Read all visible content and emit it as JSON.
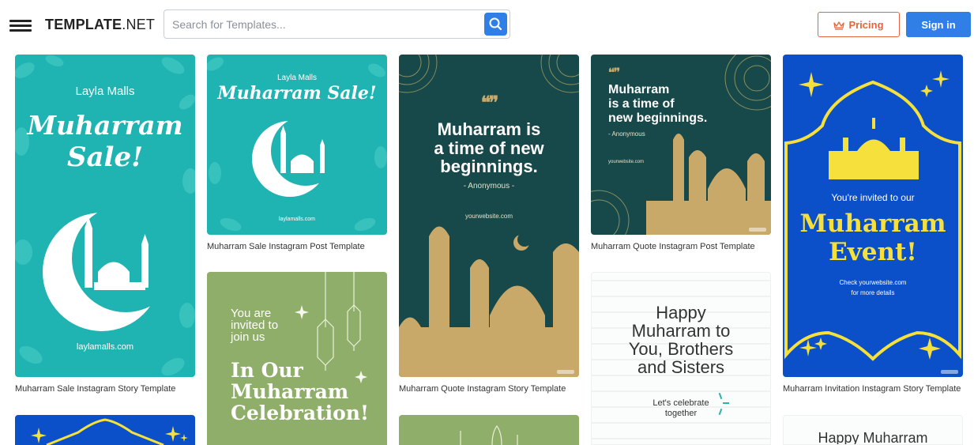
{
  "header": {
    "logo_bold": "TEMPLATE",
    "logo_light": ".NET",
    "search_placeholder": "Search for Templates...",
    "pricing_label": "Pricing",
    "signin_label": "Sign in"
  },
  "colors": {
    "accent_blue": "#2f7fe6",
    "pricing_orange": "#e8643c",
    "teal": "#1bb0b0",
    "dark_teal": "#17484a",
    "gold": "#c8a96a",
    "royal_blue": "#0b50c8",
    "yellow": "#f5e03c",
    "sage": "#8fae6a"
  },
  "cards": [
    {
      "caption": "Muharram Sale Instagram Story Template",
      "title_small": "Layla Malls",
      "title_line1": "Muharram",
      "title_line2": "Sale!",
      "website": "laylamalls.com"
    },
    {
      "caption": "Muharram Sale Instagram Post Template",
      "title_small": "Layla Malls",
      "title_main": "Muharram Sale!",
      "website": "laylamalls.com"
    },
    {
      "caption": "",
      "line1": "You are",
      "line2": "invited to",
      "line3": "join us",
      "title1": "In Our",
      "title2": "Muharram",
      "title3": "Celebration!"
    },
    {
      "caption": "Muharram Quote Instagram Story Template",
      "quote_mark": "❛❛❜❜",
      "line1": "Muharram is",
      "line2": "a time of new",
      "line3": "beginnings.",
      "author": "- Anonymous -",
      "website": "yourwebsite.com"
    },
    {
      "caption": "Muharram Quote Instagram Post Template",
      "quote_mark": "❛❛❜❜",
      "line1": "Muharram",
      "line2": "is a time of",
      "line3": "new beginnings.",
      "author": "- Anonymous",
      "website": "yourwebsite.com"
    },
    {
      "caption": "",
      "line1": "Happy",
      "line2": "Muharram to",
      "line3": "You, Brothers",
      "line4": "and Sisters",
      "small1": "Let's celebrate",
      "small2": "together"
    },
    {
      "caption": "Muharram Invitation Instagram Story Template",
      "invite": "You're invited to our",
      "title1": "Muharram",
      "title2": "Event!",
      "details1": "Check yourwebsite.com",
      "details2": "for more details"
    },
    {
      "caption": "",
      "title": "Happy Muharram"
    }
  ]
}
